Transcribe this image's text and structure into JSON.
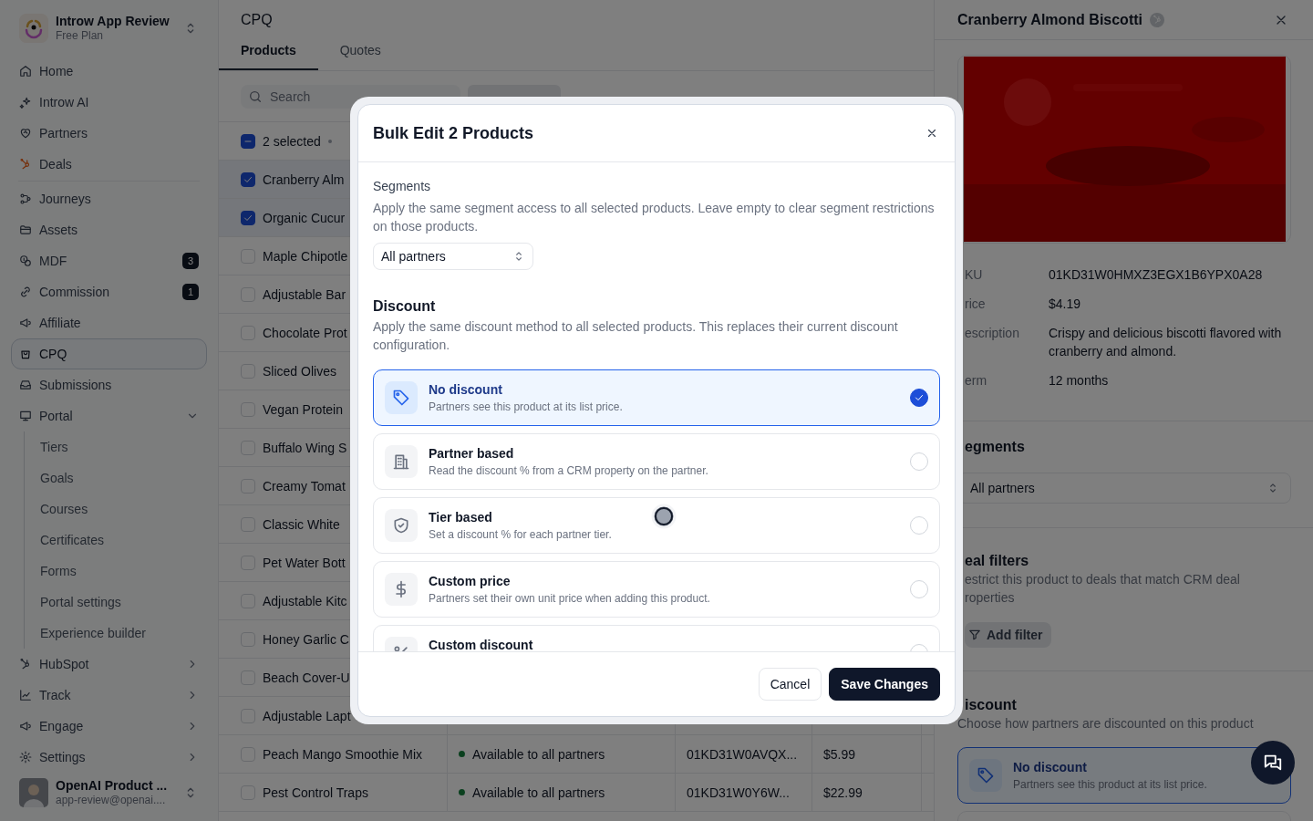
{
  "sidebar": {
    "workspace": {
      "name": "Introw App Review",
      "plan": "Free Plan"
    },
    "sections": [
      {
        "items": [
          {
            "label": "Home",
            "selected": false
          },
          {
            "label": "Introw AI",
            "selected": false
          },
          {
            "label": "Partners",
            "selected": false
          },
          {
            "label": "Deals",
            "selected": false
          }
        ]
      },
      {
        "items": [
          {
            "label": "Journeys",
            "selected": false
          },
          {
            "label": "Assets",
            "selected": false
          },
          {
            "label": "MDF",
            "selected": false,
            "badge": "3"
          },
          {
            "label": "Commission",
            "selected": false,
            "badge": "1"
          },
          {
            "label": "Affiliate",
            "selected": false
          },
          {
            "label": "CPQ",
            "selected": true
          },
          {
            "label": "Submissions",
            "selected": false
          },
          {
            "label": "Portal",
            "selected": false,
            "expanded": true,
            "children": [
              {
                "label": "Tiers",
                "selected": false
              },
              {
                "label": "Goals",
                "selected": false
              },
              {
                "label": "Courses",
                "selected": false
              },
              {
                "label": "Certificates",
                "selected": false
              },
              {
                "label": "Forms",
                "selected": false
              },
              {
                "label": "Portal settings",
                "selected": false
              },
              {
                "label": "Experience builder",
                "selected": false
              }
            ]
          },
          {
            "label": "HubSpot",
            "selected": false,
            "expanded": false
          },
          {
            "label": "Track",
            "selected": false,
            "expanded": false
          },
          {
            "label": "Engage",
            "selected": false,
            "expanded": false
          },
          {
            "label": "Settings",
            "selected": false,
            "expanded": false
          }
        ]
      }
    ],
    "user": {
      "name": "OpenAI Product ...",
      "email": "app-review@openai...."
    }
  },
  "main": {
    "title": "CPQ",
    "tabs": [
      {
        "label": "Products",
        "selected": true
      },
      {
        "label": "Quotes",
        "selected": false
      }
    ],
    "search": {
      "placeholder": "Search"
    },
    "table": {
      "header": {
        "label": "2 selected",
        "indeterminate": true
      },
      "rows": [
        {
          "name": "Cranberry Alm",
          "selected": true
        },
        {
          "name": "Organic Cucur",
          "selected": true
        },
        {
          "name": "Maple Chipotle",
          "selected": false
        },
        {
          "name": "Adjustable Bar",
          "selected": false
        },
        {
          "name": "Chocolate Prot",
          "selected": false
        },
        {
          "name": "Sliced Olives",
          "selected": false
        },
        {
          "name": "Vegan Protein",
          "selected": false
        },
        {
          "name": "Buffalo Wing S",
          "selected": false
        },
        {
          "name": "Creamy Tomat",
          "selected": false
        },
        {
          "name": "Classic White",
          "selected": false
        },
        {
          "name": "Pet Water Bott",
          "selected": false
        },
        {
          "name": "Adjustable Kitc",
          "selected": false
        },
        {
          "name": "Honey Garlic C",
          "selected": false
        },
        {
          "name": "Beach Cover-U",
          "selected": false
        },
        {
          "name": "Adjustable Lapt",
          "selected": false
        },
        {
          "name": "Peach Mango Smoothie Mix",
          "selected": false,
          "segment": "Available to all partners",
          "sku": "01KD31W0AVQX...",
          "price": "$5.99"
        },
        {
          "name": "Pest Control Traps",
          "selected": false,
          "segment": "Available to all partners",
          "sku": "01KD31W0Y6W...",
          "price": "$22.99"
        }
      ]
    }
  },
  "detail": {
    "title": "Cranberry Almond Biscotti",
    "fields": [
      {
        "label": "KU",
        "value": "01KD31W0HMXZ3EGX1B6YPX0A28"
      },
      {
        "label": "rice",
        "value": "$4.19"
      },
      {
        "label": "escription",
        "value": "Crispy and delicious biscotti flavored with cranberry and almond."
      },
      {
        "label": "erm",
        "value": "12 months"
      }
    ],
    "segments": {
      "heading": "egments",
      "value": "All partners"
    },
    "deal_filters": {
      "heading": "eal filters",
      "description_lines": [
        "estrict this product to deals that match CRM deal",
        "roperties"
      ],
      "button": "Add filter"
    },
    "discount": {
      "heading": "iscount",
      "description": "Choose how partners are discounted on this product",
      "option": {
        "title": "No discount",
        "description": "Partners see this product at its list price.",
        "selected": true
      }
    }
  },
  "modal": {
    "title": "Bulk Edit 2 Products",
    "segments": {
      "label": "Segments",
      "description": "Apply the same segment access to all selected products. Leave empty to clear segment restrictions on those products.",
      "value": "All partners"
    },
    "discount": {
      "heading": "Discount",
      "description": "Apply the same discount method to all selected products. This replaces their current discount configuration.",
      "options": [
        {
          "title": "No discount",
          "description": "Partners see this product at its list price.",
          "selected": true
        },
        {
          "title": "Partner based",
          "description": "Read the discount % from a CRM property on the partner.",
          "selected": false
        },
        {
          "title": "Tier based",
          "description": "Set a discount % for each partner tier.",
          "selected": false
        },
        {
          "title": "Custom price",
          "description": "Partners set their own unit price when adding this product.",
          "selected": false
        },
        {
          "title": "Custom discount",
          "selected": false
        }
      ]
    },
    "buttons": [
      {
        "label": "Cancel",
        "kind": "secondary"
      },
      {
        "label": "Save Changes",
        "kind": "primary"
      }
    ]
  }
}
